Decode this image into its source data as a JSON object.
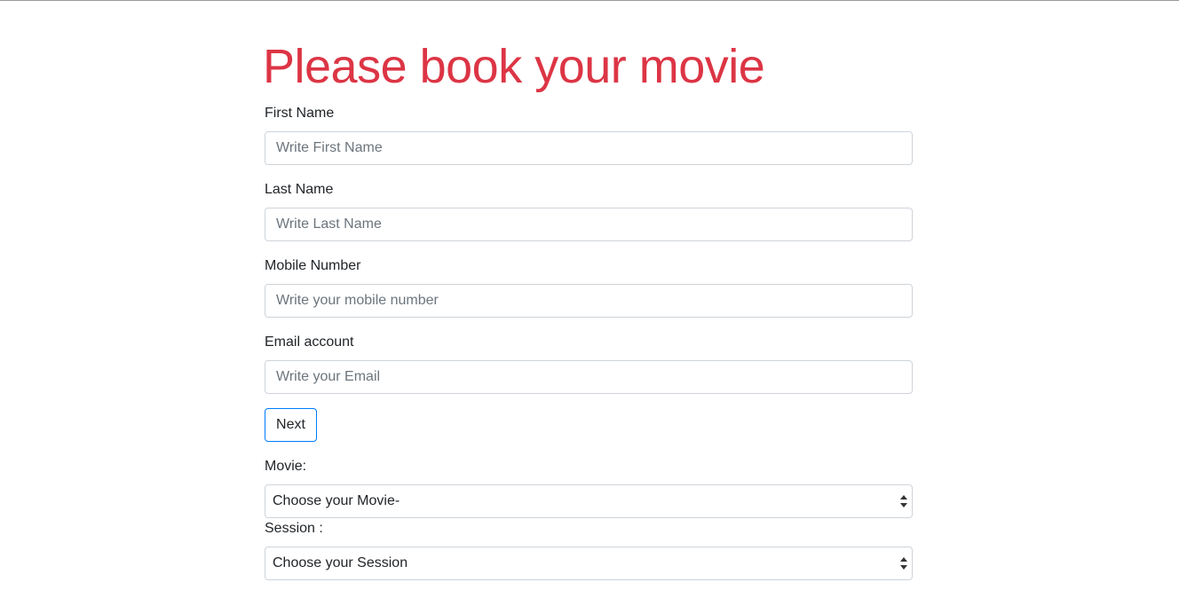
{
  "page": {
    "title": "Please book your movie"
  },
  "form": {
    "first_name": {
      "label": "First Name",
      "placeholder": "Write First Name",
      "value": ""
    },
    "last_name": {
      "label": "Last Name",
      "placeholder": "Write Last Name",
      "value": ""
    },
    "mobile": {
      "label": "Mobile Number",
      "placeholder": "Write your mobile number",
      "value": ""
    },
    "email": {
      "label": "Email account",
      "placeholder": "Write your Email",
      "value": ""
    },
    "next_label": "Next",
    "movie": {
      "label": "Movie:",
      "selected": "Choose your Movie-"
    },
    "session": {
      "label": "Session :",
      "selected": "Choose your Session"
    }
  },
  "colors": {
    "title": "#dc3545",
    "button_border": "#007bff",
    "input_border": "#ced4da"
  },
  "icons": {
    "select_arrow": "updown-chevron-icon"
  }
}
